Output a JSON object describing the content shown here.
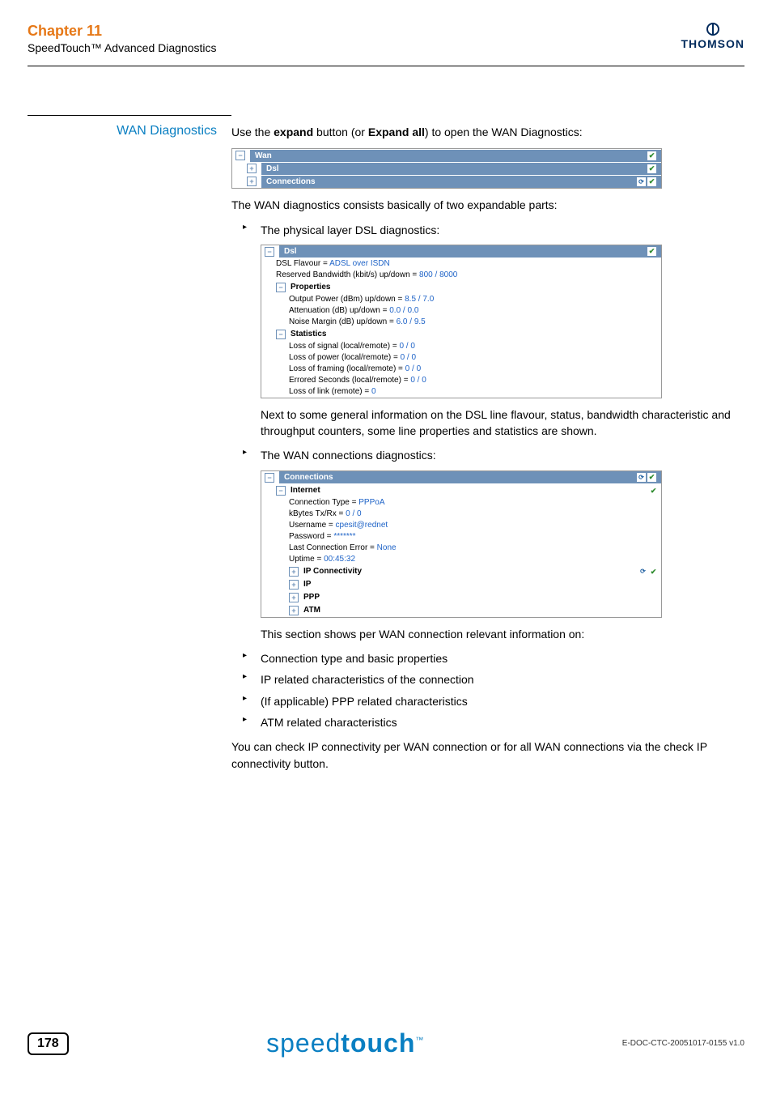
{
  "header": {
    "chapter": "Chapter 11",
    "subchapter": "SpeedTouch™ Advanced Diagnostics",
    "brand": "THOMSON"
  },
  "section": {
    "title": "WAN Diagnostics",
    "intro_pre": "Use the ",
    "intro_b1": "expand",
    "intro_mid": " button (or ",
    "intro_b2": "Expand all",
    "intro_post": ") to open the WAN Diagnostics:",
    "wan_tree": {
      "root": "Wan",
      "dsl": "Dsl",
      "connections": "Connections"
    },
    "para2": "The WAN diagnostics consists basically of two expandable parts:",
    "bullet1": "The physical layer DSL diagnostics:",
    "dsl_tree": {
      "root": "Dsl",
      "flavour_lbl": "DSL Flavour = ",
      "flavour_val": "ADSL over ISDN",
      "bw_lbl": "Reserved Bandwidth (kbit/s) up/down = ",
      "bw_val": "800 / 8000",
      "props": "Properties",
      "out_lbl": "Output Power (dBm) up/down = ",
      "out_val": "8.5 / 7.0",
      "att_lbl": "Attenuation (dB) up/down = ",
      "att_val": "0.0 / 0.0",
      "noise_lbl": "Noise Margin (dB) up/down = ",
      "noise_val": "6.0 / 9.5",
      "stats": "Statistics",
      "loss_sig_lbl": "Loss of signal (local/remote) = ",
      "loss_sig_val": "0 / 0",
      "loss_pwr_lbl": "Loss of power (local/remote) = ",
      "loss_pwr_val": "0 / 0",
      "loss_frm_lbl": "Loss of framing (local/remote) = ",
      "loss_frm_val": "0 / 0",
      "err_sec_lbl": "Errored Seconds (local/remote) = ",
      "err_sec_val": "0 / 0",
      "loss_link_lbl": "Loss of link (remote) = ",
      "loss_link_val": "0"
    },
    "para3": "Next to some general information on the DSL line flavour, status, bandwidth characteristic and throughput counters, some line properties and statistics are shown.",
    "bullet2": "The WAN connections diagnostics:",
    "conn_tree": {
      "root": "Connections",
      "internet": "Internet",
      "ctype_lbl": "Connection Type = ",
      "ctype_val": "PPPoA",
      "kbytes_lbl": "kBytes Tx/Rx = ",
      "kbytes_val": "0 / 0",
      "user_lbl": "Username = ",
      "user_val": "cpesit@rednet",
      "pass_lbl": "Password = ",
      "pass_val": "*******",
      "lasterr_lbl": "Last Connection Error = ",
      "lasterr_val": "None",
      "uptime_lbl": "Uptime = ",
      "uptime_val": "00:45:32",
      "ipconn": "IP Connectivity",
      "ip": "IP",
      "ppp": "PPP",
      "atm": "ATM"
    },
    "para4": "This section shows per WAN connection relevant information on:",
    "sub_bullets": [
      "Connection type and basic properties",
      "IP related characteristics of the connection",
      "(If applicable) PPP related characteristics",
      "ATM related characteristics"
    ],
    "para5": "You can check IP connectivity per WAN connection or for all WAN connections via the check IP connectivity button."
  },
  "footer": {
    "page": "178",
    "brand_light": "speed",
    "brand_bold": "touch",
    "tm": "™",
    "docid": "E-DOC-CTC-20051017-0155 v1.0"
  }
}
